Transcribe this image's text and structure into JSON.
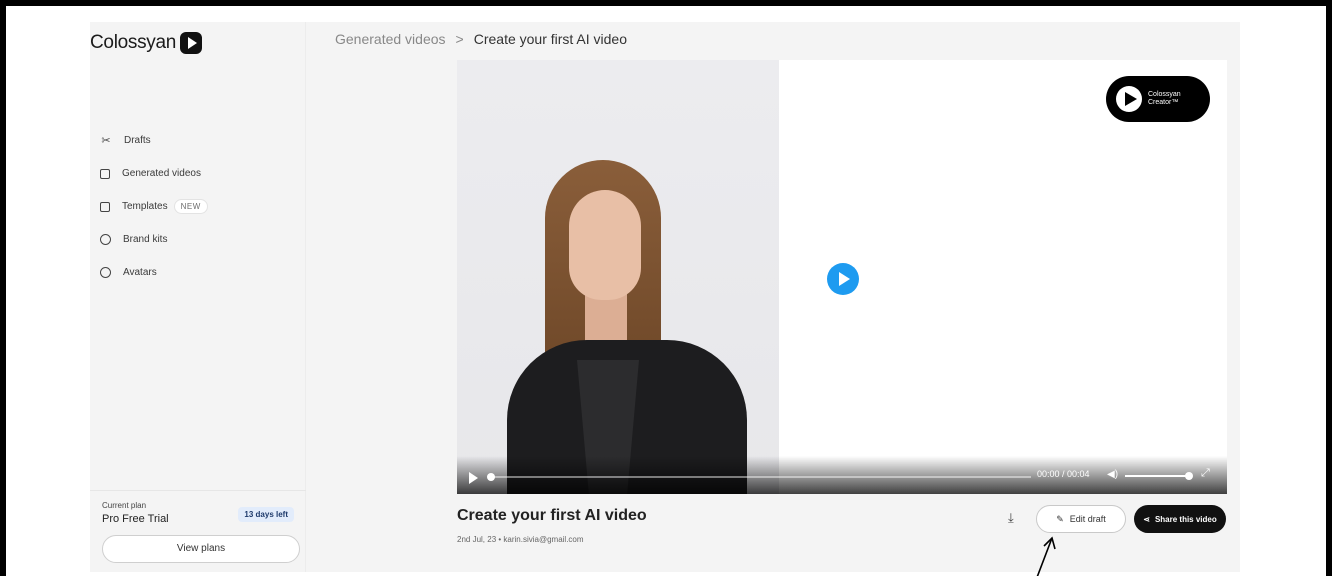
{
  "app": {
    "brand": "Colossyan"
  },
  "breadcrumb": {
    "parent": "Generated videos",
    "separator": ">",
    "current": "Create your first AI video"
  },
  "sidebar": {
    "items": [
      {
        "label": "Drafts",
        "icon": "scissors-icon"
      },
      {
        "label": "Generated videos",
        "icon": "video-archive-icon"
      },
      {
        "label": "Templates",
        "icon": "template-icon",
        "badge": "NEW"
      },
      {
        "label": "Brand kits",
        "icon": "brand-kit-icon"
      },
      {
        "label": "Avatars",
        "icon": "avatar-icon"
      }
    ],
    "plan": {
      "label": "Current plan",
      "name": "Pro Free Trial",
      "days_left": "13 days left",
      "view_plans": "View plans"
    }
  },
  "player": {
    "watermark_line1": "Colossyan",
    "watermark_line2": "Creator™",
    "time": "00:00 / 00:04",
    "progress": 0,
    "volume": 1
  },
  "video": {
    "title": "Create your first AI video",
    "meta": "2nd Jul, 23 • karin.sivia@gmail.com"
  },
  "actions": {
    "edit_draft": "Edit draft",
    "share": "Share this video"
  },
  "colors": {
    "accent_play": "#1e9bf0",
    "share_bg": "#111111",
    "sidebar_bg": "#f4f4f4"
  }
}
